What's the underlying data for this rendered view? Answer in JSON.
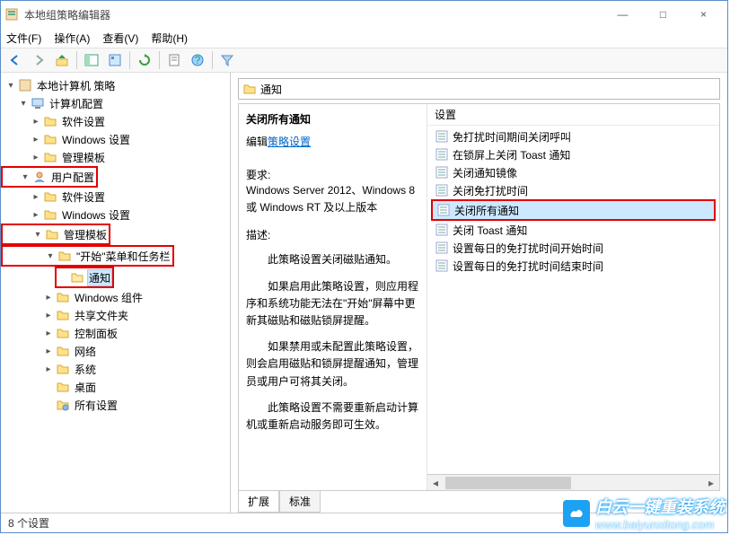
{
  "window": {
    "title": "本地组策略编辑器",
    "minimize": "—",
    "maximize": "□",
    "close": "×"
  },
  "menu": {
    "file": "文件(F)",
    "action": "操作(A)",
    "view": "查看(V)",
    "help": "帮助(H)"
  },
  "tree": {
    "root": "本地计算机 策略",
    "computer_cfg": "计算机配置",
    "sw_settings_c": "软件设置",
    "win_settings_c": "Windows 设置",
    "admin_templates_c": "管理模板",
    "user_cfg": "用户配置",
    "sw_settings_u": "软件设置",
    "win_settings_u": "Windows 设置",
    "admin_templates_u": "管理模板",
    "start_taskbar": "\"开始\"菜单和任务栏",
    "notifications": "通知",
    "win_components": "Windows 组件",
    "shared_folders": "共享文件夹",
    "control_panel": "控制面板",
    "network": "网络",
    "system": "系统",
    "desktop": "桌面",
    "all_settings": "所有设置"
  },
  "path": {
    "current": "通知"
  },
  "detail": {
    "title": "关闭所有通知",
    "edit_link_prefix": "编辑",
    "edit_link": "策略设置",
    "req_label": "要求:",
    "req_text": "Windows Server 2012、Windows 8 或 Windows RT 及以上版本",
    "desc_label": "描述:",
    "p1": "此策略设置关闭磁贴通知。",
    "p2": "如果启用此策略设置，则应用程序和系统功能无法在\"开始\"屏幕中更新其磁贴和磁贴锁屏提醒。",
    "p3": "如果禁用或未配置此策略设置，则会启用磁贴和锁屏提醒通知，管理员或用户可将其关闭。",
    "p4": "此策略设置不需要重新启动计算机或重新启动服务即可生效。"
  },
  "settings": {
    "header": "设置",
    "items": [
      "免打扰时间期间关闭呼叫",
      "在锁屏上关闭 Toast 通知",
      "关闭通知镜像",
      "关闭免打扰时间",
      "关闭所有通知",
      "关闭 Toast 通知",
      "设置每日的免打扰时间开始时间",
      "设置每日的免打扰时间结束时间"
    ],
    "selected_index": 4
  },
  "tabs": {
    "extended": "扩展",
    "standard": "标准"
  },
  "status": {
    "text": "8 个设置"
  },
  "watermark": {
    "brand": "白云一键重装系统",
    "url": "www.baiyunxitong.com"
  }
}
